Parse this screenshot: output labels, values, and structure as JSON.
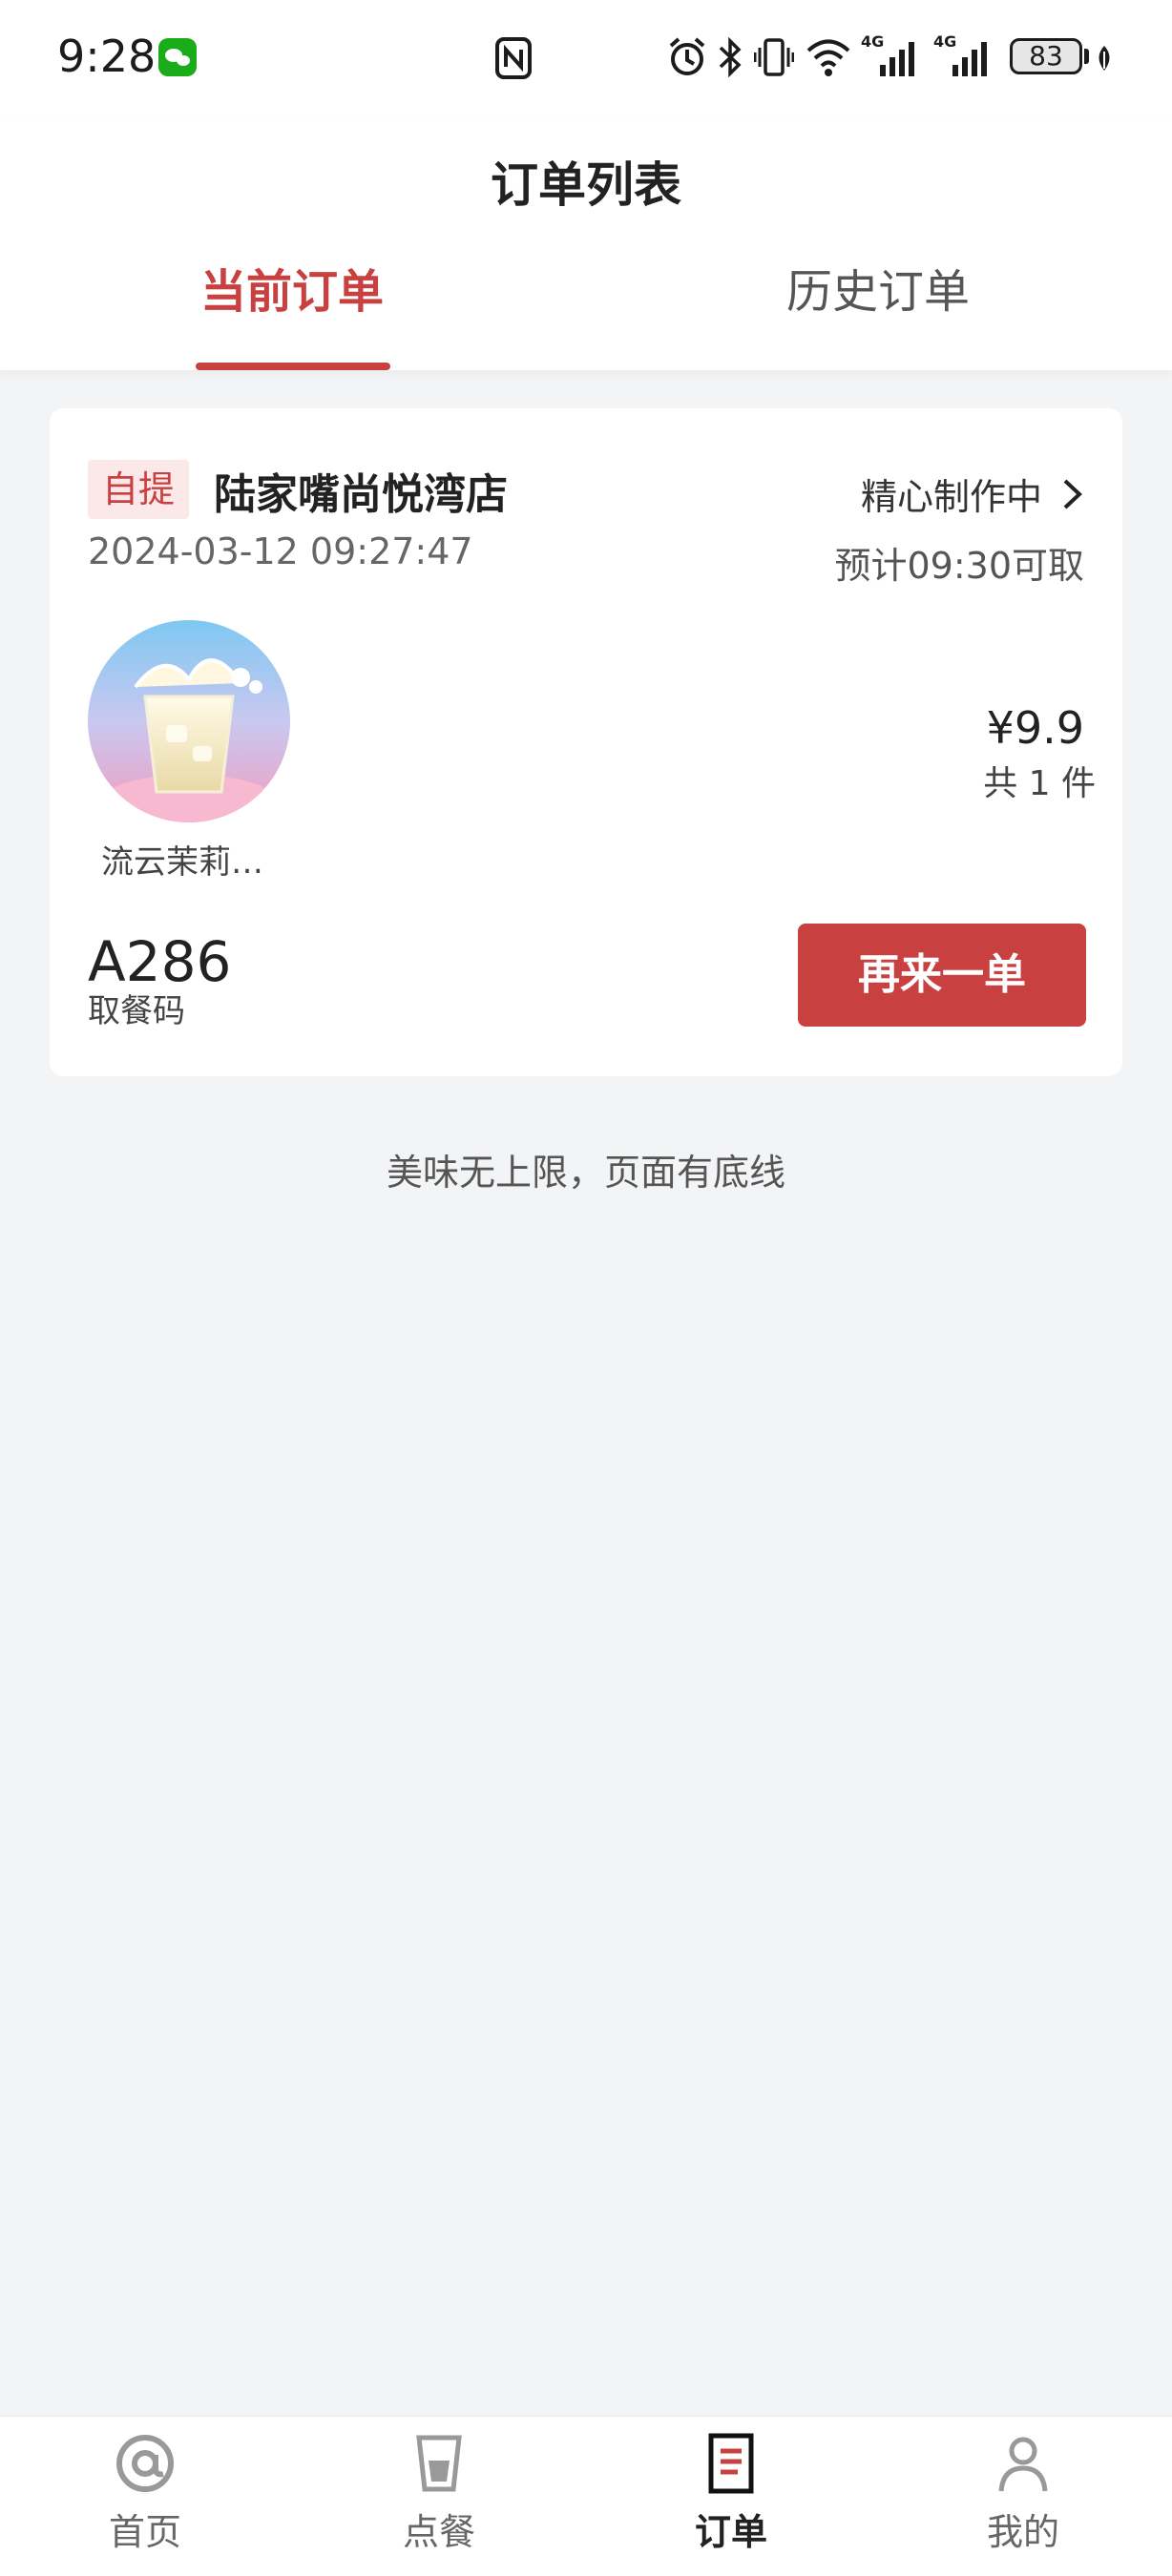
{
  "status_bar": {
    "time": "9:28",
    "battery": "83",
    "network_1": "4G",
    "network_2": "4G",
    "icons": [
      "wechat-icon",
      "nfc-icon",
      "alarm-icon",
      "bluetooth-icon",
      "vibrate-icon",
      "wifi-icon",
      "signal-icon",
      "battery-icon",
      "leaf-icon"
    ]
  },
  "header": {
    "title": "订单列表",
    "tabs": [
      {
        "label": "当前订单",
        "active": true
      },
      {
        "label": "历史订单",
        "active": false
      }
    ]
  },
  "order": {
    "badge": "自提",
    "store_name": "陆家嘴尚悦湾店",
    "order_time": "2024-03-12 09:27:47",
    "status": "精心制作中",
    "pickup_eta": "预计09:30可取",
    "product_name": "流云茉莉…",
    "price": "¥9.9",
    "quantity": "共 1 件",
    "pickup_code": "A286",
    "pickup_code_label": "取餐码",
    "reorder_label": "再来一单"
  },
  "footer_note": "美味无上限，页面有底线",
  "bottom_nav": {
    "items": [
      {
        "label": "首页",
        "icon": "home-at-icon",
        "active": false
      },
      {
        "label": "点餐",
        "icon": "cup-icon",
        "active": false
      },
      {
        "label": "订单",
        "icon": "order-list-icon",
        "active": true
      },
      {
        "label": "我的",
        "icon": "person-icon",
        "active": false
      }
    ]
  },
  "colors": {
    "accent": "#c8403f",
    "background": "#f3f4f6",
    "card": "#ffffff"
  }
}
